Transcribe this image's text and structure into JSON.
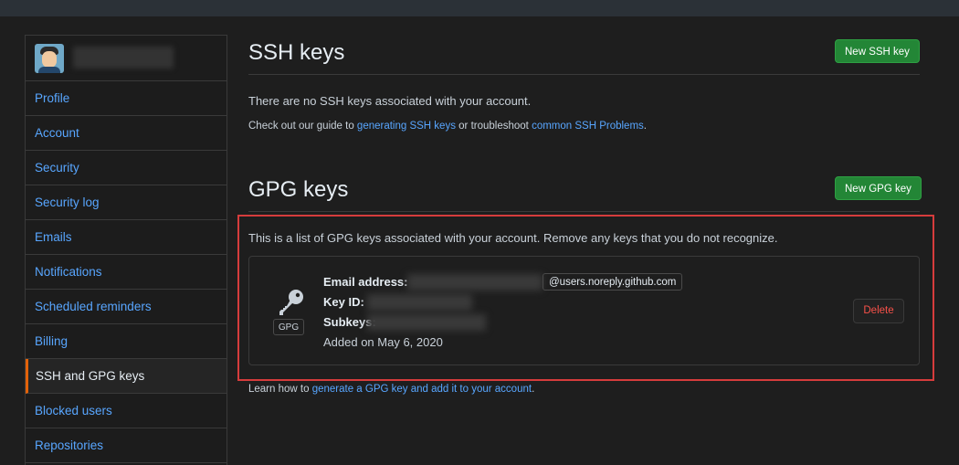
{
  "sidebar": {
    "items": [
      {
        "label": "Profile"
      },
      {
        "label": "Account"
      },
      {
        "label": "Security"
      },
      {
        "label": "Security log"
      },
      {
        "label": "Emails"
      },
      {
        "label": "Notifications"
      },
      {
        "label": "Scheduled reminders"
      },
      {
        "label": "Billing"
      },
      {
        "label": "SSH and GPG keys"
      },
      {
        "label": "Blocked users"
      },
      {
        "label": "Repositories"
      }
    ],
    "selected": "SSH and GPG keys",
    "selected_accent": "#e36209"
  },
  "ssh": {
    "title": "SSH keys",
    "new_button": "New SSH key",
    "empty_text": "There are no SSH keys associated with your account.",
    "guide_prefix": "Check out our guide to ",
    "guide_link": "generating SSH keys",
    "guide_middle": " or troubleshoot ",
    "problems_link": "common SSH Problems",
    "guide_suffix": "."
  },
  "gpg": {
    "title": "GPG keys",
    "new_button": "New GPG key",
    "intro": "This is a list of GPG keys associated with your account. Remove any keys that you do not recognize.",
    "key": {
      "badge": "GPG",
      "email_label": "Email address:",
      "email_suffix": "@users.noreply.github.com",
      "keyid_label": "Key ID:",
      "subkeys_label": "Subkeys:",
      "added": "Added on May 6, 2020",
      "delete_button": "Delete"
    },
    "learn_prefix": "Learn how to ",
    "learn_link": "generate a GPG key and add it to your account",
    "learn_suffix": "."
  },
  "colors": {
    "primary_button": "#238636",
    "link": "#58a6ff",
    "danger": "#f85149",
    "highlight_border": "#d63c3c"
  }
}
